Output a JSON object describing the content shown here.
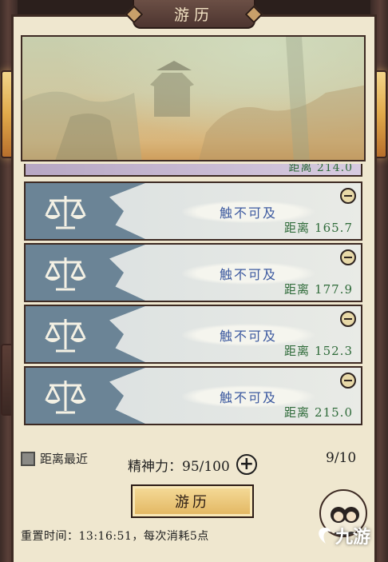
{
  "header": {
    "title": "游历"
  },
  "partial_row": {
    "distance_label": "距离",
    "distance_value": "214.0"
  },
  "destinations": [
    {
      "name": "触不可及",
      "distance_label": "距离",
      "distance_value": "165.7",
      "icon": "scale-icon"
    },
    {
      "name": "触不可及",
      "distance_label": "距离",
      "distance_value": "177.9",
      "icon": "scale-icon"
    },
    {
      "name": "触不可及",
      "distance_label": "距离",
      "distance_value": "152.3",
      "icon": "scale-icon"
    },
    {
      "name": "触不可及",
      "distance_label": "距离",
      "distance_value": "215.0",
      "icon": "scale-icon"
    }
  ],
  "filter": {
    "label": "距离最近",
    "checked": true
  },
  "energy": {
    "label": "精神力：95/100"
  },
  "count": {
    "label": "9/10"
  },
  "action": {
    "travel_label": "游历"
  },
  "footer": {
    "reset_info": "重置时间：13:16:51，每次消耗5点"
  },
  "watermark": {
    "text": "九游"
  },
  "colors": {
    "panel": "#efe7cf",
    "distance_green": "#2f6b3a",
    "name_blue": "#3d5aa0",
    "button_gold": "#e2b560"
  }
}
